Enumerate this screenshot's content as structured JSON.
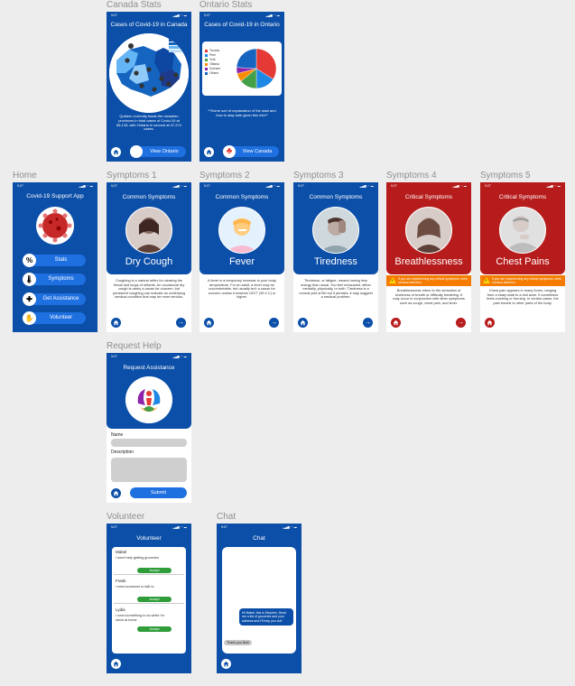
{
  "screens": {
    "canada": {
      "label": "Canada Stats",
      "title": "Cases of Covid-19 in Canada",
      "body": "Québec currently leads the canadian provinces in total cases of Covid-19 at 68,128, with Ontario in second at 47,274 cases.",
      "footer_button": "View Ontario",
      "map_title": "Canada"
    },
    "ontario": {
      "label": "Ontario Stats",
      "title": "Cases of Covid-19 in Ontario",
      "body": "**Some sort of explanation of the data and how to stay safe given this info**",
      "footer_button": "View Canada"
    },
    "home": {
      "label": "Home",
      "title": "Covid-19 Support App",
      "menu": [
        {
          "label": "Stats",
          "icon": "%"
        },
        {
          "label": "Symptoms",
          "icon": "🌡"
        },
        {
          "label": "Get Assistance",
          "icon": "✚"
        },
        {
          "label": "Volunteer",
          "icon": "✋"
        }
      ]
    },
    "symptoms": [
      {
        "label": "Symptoms 1",
        "header": "Common Symptoms",
        "title": "Dry Cough",
        "critical": false,
        "body": "Coughing is a natural reflex for clearing the throat and lungs of irritants. An occasional dry cough is rarely a cause for concern, but persistent coughing can indicate an underlying medical condition that may be more serious."
      },
      {
        "label": "Symptoms 2",
        "header": "Common Symptoms",
        "title": "Fever",
        "critical": false,
        "body": "A fever is a temporary increase in your body temperature. For an adult, a fever may be uncomfortable, but usually isn't a cause for concern unless it reaches 103 F (39.4 C) or higher."
      },
      {
        "label": "Symptoms 3",
        "header": "Common Symptoms",
        "title": "Tiredness",
        "critical": false,
        "body": "Tiredness, or fatigue, means having less energy than usual. You feel exhausted, either mentally, physically, or both. Tiredness is a normal part of life but it persists, it may suggest a medical problem."
      },
      {
        "label": "Symptoms 4",
        "header": "Critical Symptoms",
        "title": "Breathlessness",
        "critical": true,
        "warning": "If you are experiencing any critical symptoms, seek medical attention.",
        "body": "Breathlessness refers to the sensation of shortness of breath or difficulty breathing. It may occur in conjunction with other symptoms such as cough, chest pain, and fever."
      },
      {
        "label": "Symptoms 5",
        "header": "Critical Symptoms",
        "title": "Chest Pains",
        "critical": true,
        "warning": "If you are experiencing any critical symptoms, seek medical attention.",
        "body": "Chest pain appears in many forms, ranging from a sharp stab to a dull ache. It sometimes feels crushing or burning. In certain cases, the pain travels to other parts of the body."
      }
    ],
    "request": {
      "label": "Request Help",
      "title": "Request Assistance",
      "name_label": "Name",
      "description_label": "Description",
      "submit": "Submit"
    },
    "volunteer": {
      "label": "Volunteer",
      "title": "Volunteer",
      "items": [
        {
          "name": "Mabel",
          "message": "I need help getting groceries",
          "action": "Accept"
        },
        {
          "name": "Frank",
          "message": "I need someone to talk to",
          "action": "Accept"
        },
        {
          "name": "Lydia",
          "message": "I need something to do while I'm stuck at home",
          "action": "Accept"
        }
      ]
    },
    "chat": {
      "label": "Chat",
      "title": "Chat",
      "sent": "Hi Mabel, this is Stephen. Send me a list of groceries and your address and I'll help you out!",
      "received": "Thank you Bob!"
    }
  },
  "status_bar": {
    "time": "9:27",
    "signal": "▂▄▆ ◠ ▬"
  },
  "colors": {
    "primary": "#0c4fa8",
    "button": "#1e6fe0",
    "critical": "#b71c1c",
    "warning": "#f57c00",
    "accept": "#2e9d3a"
  },
  "pie_data": {
    "type": "pie",
    "legend": [
      "Toronto",
      "Peel",
      "York",
      "Ottawa",
      "Durham",
      "Others"
    ],
    "values": [
      34,
      16,
      14,
      7,
      5,
      24
    ],
    "colors": [
      "#e53935",
      "#1e88e5",
      "#43a047",
      "#fb8c00",
      "#8e24aa",
      "#1565c0"
    ]
  }
}
